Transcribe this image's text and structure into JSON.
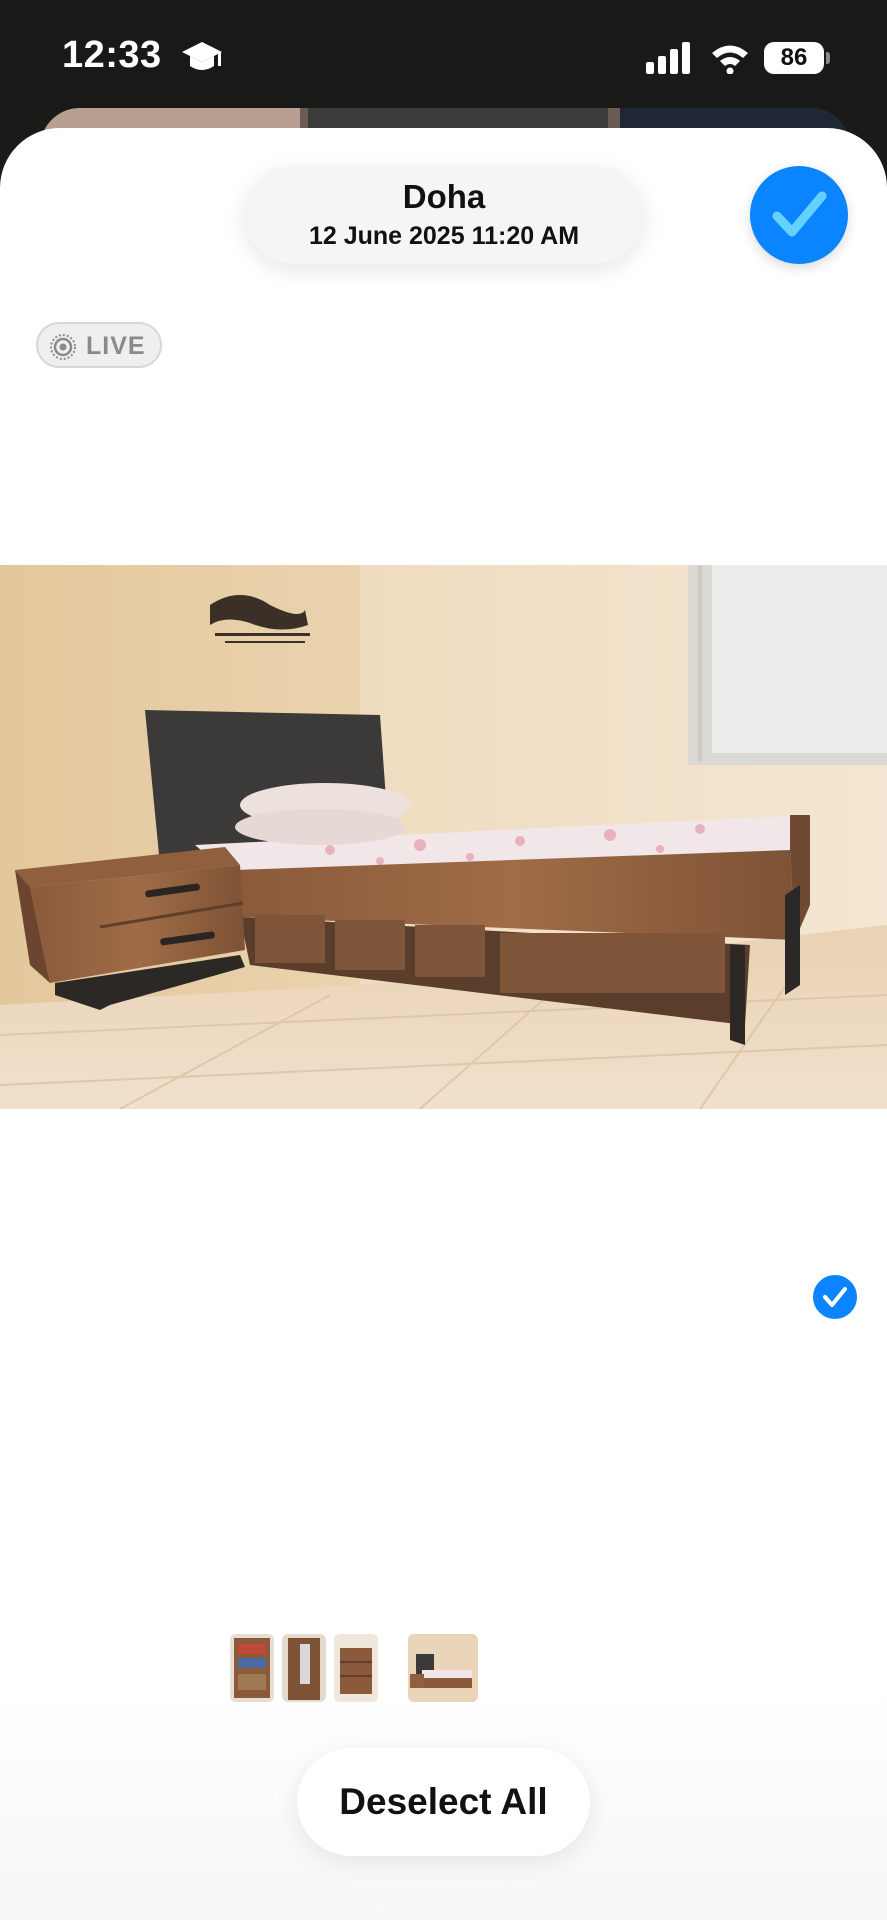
{
  "status_bar": {
    "time": "12:33",
    "battery": "86",
    "icons": [
      "graduation-cap-icon",
      "cellular-signal-icon",
      "wifi-icon",
      "battery-icon"
    ]
  },
  "header": {
    "location": "Doha",
    "datetime": "12 June 2025  11:20 AM"
  },
  "badges": {
    "live": "LIVE"
  },
  "photo": {
    "selected": true
  },
  "thumbnails": [
    {
      "name": "thumb-bookshelf",
      "selected": false
    },
    {
      "name": "thumb-wardrobe",
      "selected": false
    },
    {
      "name": "thumb-drawers",
      "selected": false
    },
    {
      "name": "thumb-bed",
      "selected": true
    }
  ],
  "footer": {
    "deselect_label": "Deselect All"
  },
  "colors": {
    "accent": "#0a84ff",
    "check": "#64d2ff"
  }
}
